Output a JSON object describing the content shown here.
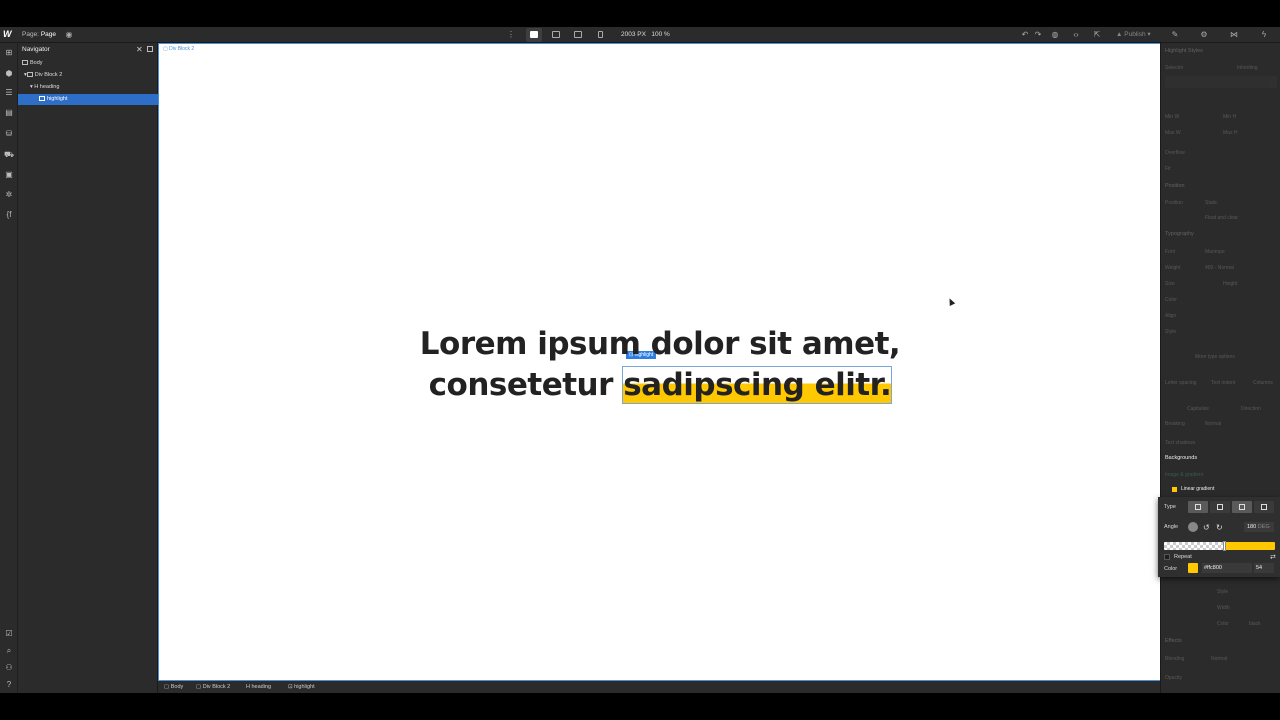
{
  "topbar": {
    "page_prefix": "Page:",
    "page_name": "Page",
    "canvas_width": "2003 PX",
    "zoom": "100 %",
    "publish_label": "Publish"
  },
  "navigator": {
    "title": "Navigator",
    "tree": [
      {
        "label": "Body"
      },
      {
        "label": "Div Block 2"
      },
      {
        "label": "heading"
      },
      {
        "label": "highlight"
      }
    ]
  },
  "canvas": {
    "div_label": "Div Block 2",
    "heading_line1": "Lorem ipsum dolor sit amet,",
    "heading_line2_plain": "consetetur ",
    "heading_line2_highlight": "sadipscing elitr.",
    "selection_tag": "highlight"
  },
  "breadcrumb": [
    "Body",
    "Div Block 2",
    "heading",
    "highlight"
  ],
  "style_panel": {
    "selector_title": "Highlight Styles",
    "selector_label": "Selector",
    "selector_inheriting": "Inheriting",
    "min_w": "Min W",
    "min_h": "Min H",
    "max_w": "Max W",
    "max_h": "Max H",
    "overflow": "Overflow",
    "fit": "Fit",
    "position_section": "Position",
    "position_label": "Position",
    "position_value": "Static",
    "float_clear": "Float and clear",
    "typography_section": "Typography",
    "font_label": "Font",
    "font_value": "Manrope",
    "weight_label": "Weight",
    "weight_value": "400 - Normal",
    "size_label": "Size",
    "height_label": "Height",
    "color_label": "Color",
    "align_label": "Align",
    "style_label": "Style",
    "more_type": "More type options",
    "letter_spacing": "Letter spacing",
    "text_indent": "Text indent",
    "columns": "Columns",
    "capitalize": "Capitalize",
    "direction": "Direction",
    "breaking_label": "Breaking",
    "breaking_value": "Normal",
    "text_shadows": "Text shadows",
    "backgrounds_section": "Backgrounds",
    "image_gradient": "Image & gradient",
    "linear_gradient": "Linear gradient",
    "effects_section": "Effects",
    "blending_label": "Blending",
    "blending_value": "Normal",
    "opacity_label": "Opacity",
    "border_style": "Style",
    "border_width": "Width",
    "border_color": "Color",
    "border_color_value": "black"
  },
  "gradient_editor": {
    "type_label": "Type",
    "angle_label": "Angle",
    "angle_value": "180",
    "angle_unit": "DEG",
    "repeat_label": "Repeat",
    "color_label": "Color",
    "color_hex": "#ffc800",
    "color_stop_pct": "54",
    "accent": "#ffc800"
  }
}
